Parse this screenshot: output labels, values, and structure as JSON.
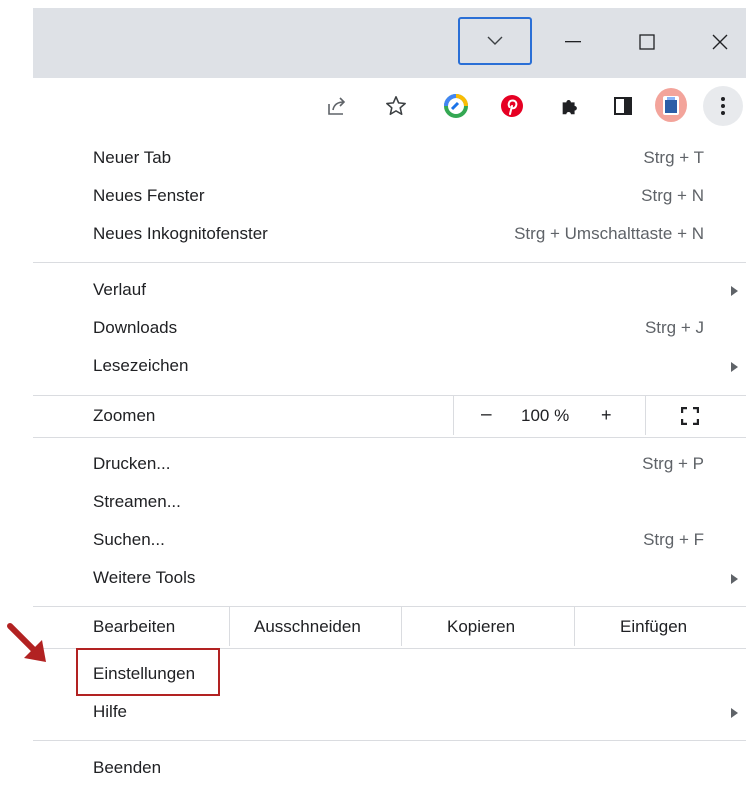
{
  "window": {
    "controls": [
      "tab-search",
      "minimize",
      "maximize",
      "close"
    ]
  },
  "toolbar": {
    "icons": [
      "share-icon",
      "star-icon",
      "extension-colorful-icon",
      "pinterest-icon",
      "puzzle-icon",
      "side-panel-icon",
      "profile-avatar",
      "kebab-menu-icon"
    ]
  },
  "menu": {
    "new_tab": {
      "label": "Neuer Tab",
      "shortcut": "Strg + T"
    },
    "new_window": {
      "label": "Neues Fenster",
      "shortcut": "Strg + N"
    },
    "incognito": {
      "label": "Neues Inkognitofenster",
      "shortcut": "Strg + Umschalttaste + N"
    },
    "history": {
      "label": "Verlauf"
    },
    "downloads": {
      "label": "Downloads",
      "shortcut": "Strg + J"
    },
    "bookmarks": {
      "label": "Lesezeichen"
    },
    "zoom": {
      "label": "Zoomen",
      "minus": "–",
      "value": "100 %",
      "plus": "+"
    },
    "print": {
      "label": "Drucken...",
      "shortcut": "Strg + P"
    },
    "cast": {
      "label": "Streamen..."
    },
    "find": {
      "label": "Suchen...",
      "shortcut": "Strg + F"
    },
    "more_tools": {
      "label": "Weitere Tools"
    },
    "edit": {
      "label": "Bearbeiten",
      "cut": "Ausschneiden",
      "copy": "Kopieren",
      "paste": "Einfügen"
    },
    "settings": {
      "label": "Einstellungen"
    },
    "help": {
      "label": "Hilfe"
    },
    "exit": {
      "label": "Beenden"
    }
  },
  "colors": {
    "titlebar": "#dee1e6",
    "focus_ring": "#2a6fd6",
    "annotation": "#b22222",
    "separator": "#dadce0"
  }
}
